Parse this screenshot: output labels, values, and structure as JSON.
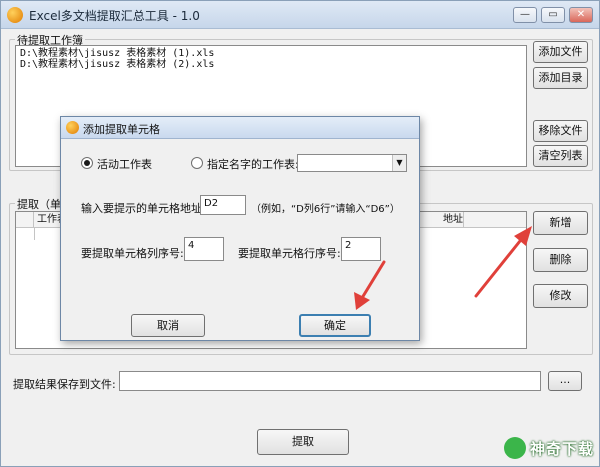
{
  "window": {
    "title": "Excel多文档提取汇总工具 - 1.0",
    "controls": {
      "minimize": "—",
      "restore": "▭",
      "close": "✕"
    }
  },
  "workbooks": {
    "group_label": "待提取工作簿",
    "files": [
      "D:\\教程素材\\jisusz 表格素材 (1).xls",
      "D:\\教程素材\\jisusz 表格素材 (2).xls"
    ],
    "buttons": {
      "add_file": "添加文件",
      "add_folder": "添加目录",
      "remove_file": "移除文件",
      "clear_list": "清空列表"
    }
  },
  "extract": {
    "group_label": "提取（单元",
    "columns": {
      "sheet": "工作表",
      "address": "地址"
    },
    "buttons": {
      "add": "新增",
      "delete": "删除",
      "modify": "修改"
    }
  },
  "save": {
    "label": "提取结果保存到文件:",
    "path": "",
    "browse": "..."
  },
  "extract_button": "提取",
  "dialog": {
    "title": "添加提取单元格",
    "radio_active": "活动工作表",
    "radio_named": "指定名字的工作表:",
    "sheet_name_value": "",
    "address_label": "输入要提示的单元格地址:",
    "address_value": "D2",
    "address_hint": "（例如，“D列6行”请输入“D6”）",
    "col_label": "要提取单元格列序号:",
    "col_value": "4",
    "row_label": "要提取单元格行序号:",
    "row_value": "2",
    "cancel": "取消",
    "ok": "确定"
  },
  "watermark": "神奇下载",
  "colors": {
    "annotation_arrow": "#e0403a",
    "watermark_green": "#3bb54a"
  }
}
